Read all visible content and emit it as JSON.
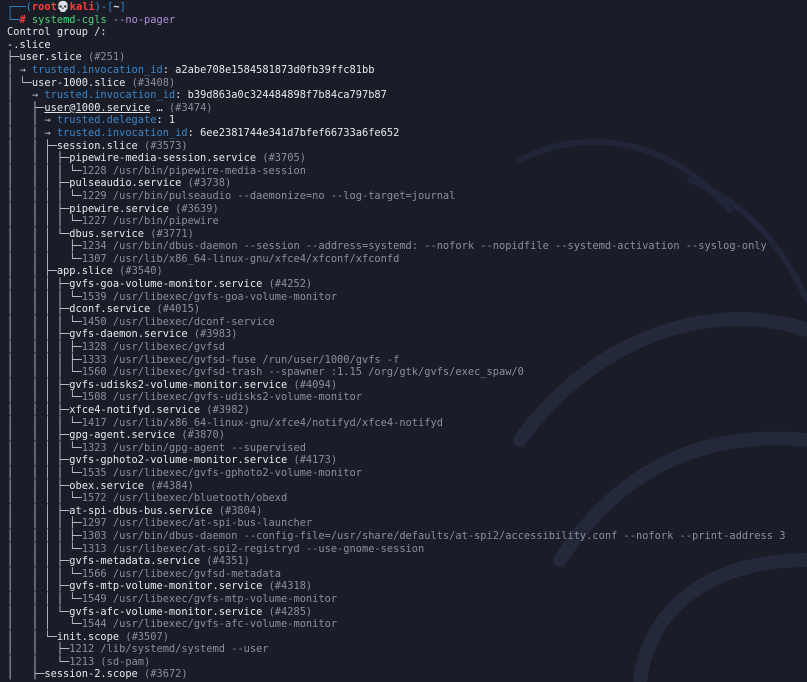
{
  "colors": {
    "background": "#1a1d27",
    "prompt_frame": "#2e8ad3",
    "user_host": "#ff3a3a",
    "command": "#4fd37a",
    "argument": "#b28bd8",
    "property_key": "#3c84c7",
    "pid_and_cmdline": "#8b8f99"
  },
  "prompt": {
    "frame_top_left": "┌──(",
    "user": "root",
    "skull": "💀",
    "host": "kali",
    "frame_mid": ")-[",
    "cwd": "~",
    "frame_end": "]",
    "frame_bottom_left": "└─",
    "hash": "#",
    "command": "systemd-cgls",
    "argument": "--no-pager"
  },
  "output": {
    "header": "Control group /:",
    "lines": [
      [
        {
          "c": "name",
          "t": "-.slice"
        }
      ],
      [
        {
          "c": "tree",
          "t": "├─"
        },
        {
          "c": "name",
          "t": "user.slice"
        },
        {
          "c": "pid",
          "t": " (#251)"
        }
      ],
      [
        {
          "c": "tree",
          "t": "│ → "
        },
        {
          "c": "key",
          "t": "trusted.invocation_id"
        },
        {
          "c": "val",
          "t": ": a2abe708e1584581873d0fb39ffc81bb"
        }
      ],
      [
        {
          "c": "tree",
          "t": "│ └─"
        },
        {
          "c": "name",
          "t": "user-1000.slice"
        },
        {
          "c": "pid",
          "t": " (#3408)"
        }
      ],
      [
        {
          "c": "tree",
          "t": "│   → "
        },
        {
          "c": "key",
          "t": "trusted.invocation_id"
        },
        {
          "c": "val",
          "t": ": b39d863a0c324484898f7b84ca797b87"
        }
      ],
      [
        {
          "c": "tree",
          "t": "│   ├─"
        },
        {
          "c": "name u",
          "t": "user@1000.service"
        },
        {
          "c": "name",
          "t": " …"
        },
        {
          "c": "pid",
          "t": " (#3474)"
        }
      ],
      [
        {
          "c": "tree",
          "t": "│   │ → "
        },
        {
          "c": "key",
          "t": "trusted.delegate"
        },
        {
          "c": "val",
          "t": ": 1"
        }
      ],
      [
        {
          "c": "tree",
          "t": "│   │ → "
        },
        {
          "c": "key",
          "t": "trusted.invocation_id"
        },
        {
          "c": "val",
          "t": ": 6ee2381744e341d7bfef66733a6fe652"
        }
      ],
      [
        {
          "c": "tree",
          "t": "│   │ ├─"
        },
        {
          "c": "name",
          "t": "session.slice"
        },
        {
          "c": "pid",
          "t": " (#3573)"
        }
      ],
      [
        {
          "c": "tree",
          "t": "│   │ │ ├─"
        },
        {
          "c": "name",
          "t": "pipewire-media-session.service"
        },
        {
          "c": "pid",
          "t": " (#3705)"
        }
      ],
      [
        {
          "c": "tree",
          "t": "│   │ │ │ └─"
        },
        {
          "c": "cmd",
          "t": "1228 /usr/bin/pipewire-media-session"
        }
      ],
      [
        {
          "c": "tree",
          "t": "│   │ │ ├─"
        },
        {
          "c": "name",
          "t": "pulseaudio.service"
        },
        {
          "c": "pid",
          "t": " (#3738)"
        }
      ],
      [
        {
          "c": "tree",
          "t": "│   │ │ │ └─"
        },
        {
          "c": "cmd",
          "t": "1229 /usr/bin/pulseaudio --daemonize=no --log-target=journal"
        }
      ],
      [
        {
          "c": "tree",
          "t": "│   │ │ ├─"
        },
        {
          "c": "name",
          "t": "pipewire.service"
        },
        {
          "c": "pid",
          "t": " (#3639)"
        }
      ],
      [
        {
          "c": "tree",
          "t": "│   │ │ │ └─"
        },
        {
          "c": "cmd",
          "t": "1227 /usr/bin/pipewire"
        }
      ],
      [
        {
          "c": "tree",
          "t": "│   │ │ └─"
        },
        {
          "c": "name",
          "t": "dbus.service"
        },
        {
          "c": "pid",
          "t": " (#3771)"
        }
      ],
      [
        {
          "c": "tree",
          "t": "│   │ │   ├─"
        },
        {
          "c": "cmd",
          "t": "1234 /usr/bin/dbus-daemon --session --address=systemd: --nofork --nopidfile --systemd-activation --syslog-only"
        }
      ],
      [
        {
          "c": "tree",
          "t": "│   │ │   └─"
        },
        {
          "c": "cmd",
          "t": "1307 /usr/lib/x86_64-linux-gnu/xfce4/xfconf/xfconfd"
        }
      ],
      [
        {
          "c": "tree",
          "t": "│   │ ├─"
        },
        {
          "c": "name",
          "t": "app.slice"
        },
        {
          "c": "pid",
          "t": " (#3540)"
        }
      ],
      [
        {
          "c": "tree",
          "t": "│   │ │ ├─"
        },
        {
          "c": "name",
          "t": "gvfs-goa-volume-monitor.service"
        },
        {
          "c": "pid",
          "t": " (#4252)"
        }
      ],
      [
        {
          "c": "tree",
          "t": "│   │ │ │ └─"
        },
        {
          "c": "cmd",
          "t": "1539 /usr/libexec/gvfs-goa-volume-monitor"
        }
      ],
      [
        {
          "c": "tree",
          "t": "│   │ │ ├─"
        },
        {
          "c": "name",
          "t": "dconf.service"
        },
        {
          "c": "pid",
          "t": " (#4015)"
        }
      ],
      [
        {
          "c": "tree",
          "t": "│   │ │ │ └─"
        },
        {
          "c": "cmd",
          "t": "1450 /usr/libexec/dconf-service"
        }
      ],
      [
        {
          "c": "tree",
          "t": "│   │ │ ├─"
        },
        {
          "c": "name",
          "t": "gvfs-daemon.service"
        },
        {
          "c": "pid",
          "t": " (#3983)"
        }
      ],
      [
        {
          "c": "tree",
          "t": "│   │ │ │ ├─"
        },
        {
          "c": "cmd",
          "t": "1328 /usr/libexec/gvfsd"
        }
      ],
      [
        {
          "c": "tree",
          "t": "│   │ │ │ ├─"
        },
        {
          "c": "cmd",
          "t": "1333 /usr/libexec/gvfsd-fuse /run/user/1000/gvfs -f"
        }
      ],
      [
        {
          "c": "tree",
          "t": "│   │ │ │ └─"
        },
        {
          "c": "cmd",
          "t": "1560 /usr/libexec/gvfsd-trash --spawner :1.15 /org/gtk/gvfs/exec_spaw/0"
        }
      ],
      [
        {
          "c": "tree",
          "t": "│   │ │ ├─"
        },
        {
          "c": "name",
          "t": "gvfs-udisks2-volume-monitor.service"
        },
        {
          "c": "pid",
          "t": " (#4094)"
        }
      ],
      [
        {
          "c": "tree",
          "t": "│   │ │ │ └─"
        },
        {
          "c": "cmd",
          "t": "1508 /usr/libexec/gvfs-udisks2-volume-monitor"
        }
      ],
      [
        {
          "c": "tree",
          "t": "│   │ │ ├─"
        },
        {
          "c": "name",
          "t": "xfce4-notifyd.service"
        },
        {
          "c": "pid",
          "t": " (#3982)"
        }
      ],
      [
        {
          "c": "tree",
          "t": "│   │ │ │ └─"
        },
        {
          "c": "cmd",
          "t": "1417 /usr/lib/x86_64-linux-gnu/xfce4/notifyd/xfce4-notifyd"
        }
      ],
      [
        {
          "c": "tree",
          "t": "│   │ │ ├─"
        },
        {
          "c": "name",
          "t": "gpg-agent.service"
        },
        {
          "c": "pid",
          "t": " (#3870)"
        }
      ],
      [
        {
          "c": "tree",
          "t": "│   │ │ │ └─"
        },
        {
          "c": "cmd",
          "t": "1323 /usr/bin/gpg-agent --supervised"
        }
      ],
      [
        {
          "c": "tree",
          "t": "│   │ │ ├─"
        },
        {
          "c": "name",
          "t": "gvfs-gphoto2-volume-monitor.service"
        },
        {
          "c": "pid",
          "t": " (#4173)"
        }
      ],
      [
        {
          "c": "tree",
          "t": "│   │ │ │ └─"
        },
        {
          "c": "cmd",
          "t": "1535 /usr/libexec/gvfs-gphoto2-volume-monitor"
        }
      ],
      [
        {
          "c": "tree",
          "t": "│   │ │ ├─"
        },
        {
          "c": "name",
          "t": "obex.service"
        },
        {
          "c": "pid",
          "t": " (#4384)"
        }
      ],
      [
        {
          "c": "tree",
          "t": "│   │ │ │ └─"
        },
        {
          "c": "cmd",
          "t": "1572 /usr/libexec/bluetooth/obexd"
        }
      ],
      [
        {
          "c": "tree",
          "t": "│   │ │ ├─"
        },
        {
          "c": "name",
          "t": "at-spi-dbus-bus.service"
        },
        {
          "c": "pid",
          "t": " (#3804)"
        }
      ],
      [
        {
          "c": "tree",
          "t": "│   │ │ │ ├─"
        },
        {
          "c": "cmd",
          "t": "1297 /usr/libexec/at-spi-bus-launcher"
        }
      ],
      [
        {
          "c": "tree",
          "t": "│   │ │ │ ├─"
        },
        {
          "c": "cmd",
          "t": "1303 /usr/bin/dbus-daemon --config-file=/usr/share/defaults/at-spi2/accessibility.conf --nofork --print-address 3"
        }
      ],
      [
        {
          "c": "tree",
          "t": "│   │ │ │ └─"
        },
        {
          "c": "cmd",
          "t": "1313 /usr/libexec/at-spi2-registryd --use-gnome-session"
        }
      ],
      [
        {
          "c": "tree",
          "t": "│   │ │ ├─"
        },
        {
          "c": "name",
          "t": "gvfs-metadata.service"
        },
        {
          "c": "pid",
          "t": " (#4351)"
        }
      ],
      [
        {
          "c": "tree",
          "t": "│   │ │ │ └─"
        },
        {
          "c": "cmd",
          "t": "1566 /usr/libexec/gvfsd-metadata"
        }
      ],
      [
        {
          "c": "tree",
          "t": "│   │ │ ├─"
        },
        {
          "c": "name",
          "t": "gvfs-mtp-volume-monitor.service"
        },
        {
          "c": "pid",
          "t": " (#4318)"
        }
      ],
      [
        {
          "c": "tree",
          "t": "│   │ │ │ └─"
        },
        {
          "c": "cmd",
          "t": "1549 /usr/libexec/gvfs-mtp-volume-monitor"
        }
      ],
      [
        {
          "c": "tree",
          "t": "│   │ │ └─"
        },
        {
          "c": "name",
          "t": "gvfs-afc-volume-monitor.service"
        },
        {
          "c": "pid",
          "t": " (#4285)"
        }
      ],
      [
        {
          "c": "tree",
          "t": "│   │ │   └─"
        },
        {
          "c": "cmd",
          "t": "1544 /usr/libexec/gvfs-afc-volume-monitor"
        }
      ],
      [
        {
          "c": "tree",
          "t": "│   │ └─"
        },
        {
          "c": "name",
          "t": "init.scope"
        },
        {
          "c": "pid",
          "t": " (#3507)"
        }
      ],
      [
        {
          "c": "tree",
          "t": "│   │   ├─"
        },
        {
          "c": "cmd",
          "t": "1212 /lib/systemd/systemd --user"
        }
      ],
      [
        {
          "c": "tree",
          "t": "│   │   └─"
        },
        {
          "c": "cmd",
          "t": "1213 (sd-pam)"
        }
      ],
      [
        {
          "c": "tree",
          "t": "│   ├─"
        },
        {
          "c": "name",
          "t": "session-2.scope"
        },
        {
          "c": "pid",
          "t": " (#3672)"
        }
      ]
    ]
  }
}
